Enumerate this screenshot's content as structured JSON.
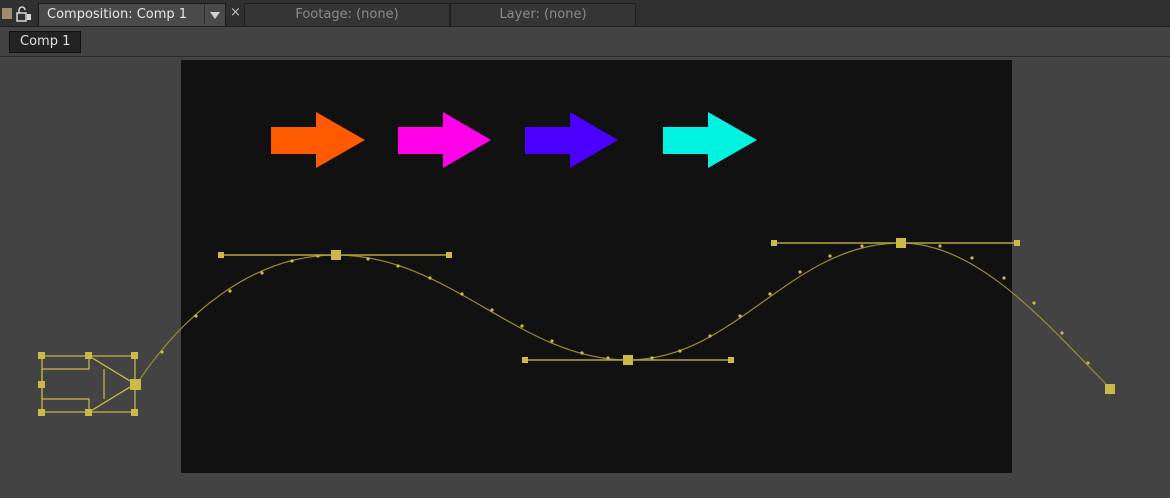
{
  "tabs": [
    {
      "label": "Composition: Comp 1",
      "active": true
    },
    {
      "label": "Footage: (none)",
      "active": false
    },
    {
      "label": "Layer: (none)",
      "active": false
    }
  ],
  "close_symbol": "×",
  "breadcrumb": "Comp 1",
  "icons": {
    "lock": "lock-icon",
    "dropdown": "chevron-down-icon",
    "close": "close-icon"
  },
  "colors": {
    "comp_background": "#111111",
    "pasteboard": "#434343",
    "path": "#cdb94a",
    "arrows": [
      "#ff5a00",
      "#ff00e9",
      "#4a00ff",
      "#00f2e0"
    ]
  }
}
